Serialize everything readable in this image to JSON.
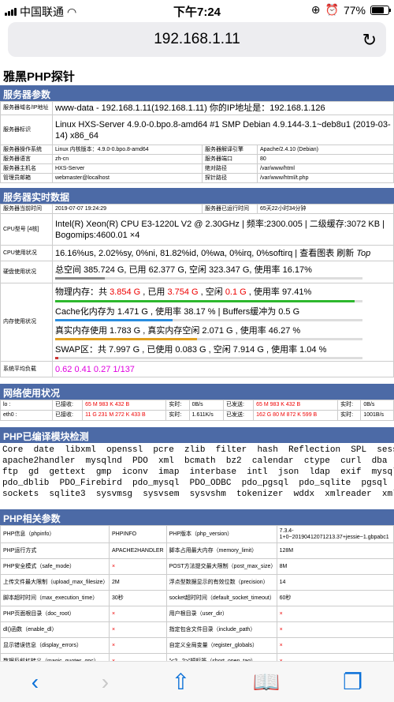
{
  "status": {
    "carrier": "中国联通",
    "time": "下午7:24",
    "battery": "77%"
  },
  "url": "192.168.1.11",
  "title": "雅黑PHP探针",
  "sec1": {
    "title": "服务器参数",
    "rows": [
      [
        "服务器域名/IP地址",
        "www-data - 192.168.1.11(192.168.1.11)  你的IP地址是：192.168.1.126"
      ],
      [
        "服务器标识",
        "Linux HXS-Server 4.9.0-0.bpo.8-amd64 #1 SMP Debian 4.9.144-3.1~deb8u1 (2019-03-14) x86_64"
      ]
    ],
    "grid": [
      [
        "服务器操作系统",
        "Linux  内核版本：4.9.0-0.bpo.8-amd64",
        "服务器解译引擎",
        "Apache/2.4.10 (Debian)"
      ],
      [
        "服务器语言",
        "zh-cn",
        "服务器端口",
        "80"
      ],
      [
        "服务器主机名",
        "HXS-Server",
        "绝对路径",
        "/var/www/html"
      ],
      [
        "管理员邮箱",
        "webmaster@localhost",
        "探针路径",
        "/var/www/html/t.php"
      ]
    ]
  },
  "sec2": {
    "title": "服务器实时数据",
    "time_label": "服务器当前时间",
    "time_value": "2019-07-07 19:24:29",
    "uptime_label": "服务器已运行时间",
    "uptime_value": "65天22小时34分钟",
    "cpu_label": "CPU型号 [4核]",
    "cpu_value": "Intel(R) Xeon(R) CPU E3-1220L V2 @ 2.30GHz | 频率:2300.005 | 二级缓存:3072 KB | Bogomips:4600.01 ×4",
    "cpuuse_label": "CPU使用状况",
    "cpuuse_value": "16.16%us, 2.02%sy, 0%ni, 81.82%id, 0%wa, 0%irq, 0%softirq | 查看图表  刷新",
    "cpuuse_top": "Top",
    "disk_label": "硬盘使用状况",
    "disk": {
      "t1": "总空间 385.724 G,  已用 ",
      "used": "62.377",
      "t2": " G,  空闲 323.347 G,  使用率 16.17%",
      "pct": 16.17
    },
    "mem_label": "内存使用状况",
    "mem1": {
      "t1": "物理内存：共 ",
      "total": "3.854 G",
      "t2": " , 已用 ",
      "used": "3.754 G",
      "t3": " , 空闲 ",
      "free": "0.1 G",
      "t4": " , 使用率 97.41%",
      "pct": 97.41
    },
    "mem2": {
      "text": "Cache化内存为 1.471 G , 使用率 38.17 % | Buffers缓冲为 0.5 G",
      "pct": 38.17
    },
    "mem3": {
      "text": "真实内存使用 1.783 G , 真实内存空闲 2.071 G , 使用率 46.27 %",
      "pct": 46.27
    },
    "mem4": {
      "text": "SWAP区：共 7.997 G , 已使用 0.083 G , 空闲 7.914 G , 使用率 1.04 %",
      "pct": 1.04
    },
    "load_label": "系统平均负载",
    "load_value": "0.62 0.41 0.27 1/137"
  },
  "sec3": {
    "title": "网络使用状况",
    "rows": [
      [
        "lo :",
        "已接收:",
        "65 M 983 K 432 B",
        "实时:",
        "0B/s",
        "已发送:",
        "65 M 983 K 432 B",
        "实时:",
        "0B/s"
      ],
      [
        "eth0 :",
        "已接收:",
        "11 G 231 M 272 K 433 B",
        "实时:",
        "1.611K/s",
        "已发送:",
        "162 G 80 M 872 K 599 B",
        "实时:",
        "1001B/s"
      ]
    ]
  },
  "sec4": {
    "title": "PHP已编译模块检测",
    "lines": [
      "Core  date  libxml  openssl  pcre  zlib  filter  hash  Reflection  SPL  session",
      "apache2handler  mysqlnd  PDO  xml  bcmath  bz2  calendar  ctype  curl  dba  dom",
      "ftp  gd  gettext  gmp  iconv  imap  interbase  intl  json  ldap  exif  mysqli",
      "pdo_dblib  PDO_Firebird  pdo_mysql  PDO_ODBC  pdo_pgsql  pdo_sqlite  pgsql",
      "sockets  sqlite3  sysvmsg  sysvsem  sysvshm  tokenizer  wddx  xmlreader  xmlrpc"
    ]
  },
  "sec5": {
    "title": "PHP相关参数",
    "rows": [
      [
        "PHP信息（phpinfo）",
        "PHPINFO",
        "PHP版本（php_version）",
        "7.3.4-1+0~20190412071213.37+jessie~1.gbpabc1"
      ],
      [
        "PHP运行方式",
        "APACHE2HANDLER",
        "脚本占用最大内存（memory_limit）",
        "128M"
      ],
      [
        "PHP安全模式（safe_mode）",
        "×",
        "POST方法提交最大限制（post_max_size）",
        "8M"
      ],
      [
        "上传文件最大限制（upload_max_filesize）",
        "2M",
        "浮点型数据显示的有效位数（precision）",
        "14"
      ],
      [
        "脚本超时时间（max_execution_time）",
        "30秒",
        "socket超时时间（default_socket_timeout）",
        "60秒"
      ],
      [
        "PHP页面根目录（doc_root）",
        "×",
        "用户根目录（user_dir）",
        "×"
      ],
      [
        "dl()函数（enable_dl）",
        "×",
        "指定包含文件目录（include_path）",
        "×"
      ],
      [
        "显示错误信息（display_errors）",
        "×",
        "自定义全局变量（register_globals）",
        "×"
      ],
      [
        "数据反斜杠转义（magic_quotes_gpc）",
        "×",
        "\"<?...?>\"短标签（short_open_tag）",
        "×"
      ],
      [
        "\"<% %>\"ASP风格标记（asp_tags）",
        "×",
        "忽略重复错误信息（ignore_repeated_errors）",
        "×"
      ],
      [
        "忽略重复的错误源",
        "",
        "",
        " "
      ]
    ]
  },
  "toolbar": {
    "back": "‹",
    "forward": "›",
    "share": "⇧",
    "books": "📖",
    "tabs": "❐"
  },
  "colors": {
    "section": "#4c6aa6",
    "red": "#e00",
    "load": "#e000e0",
    "bar_mem": "#2db82d",
    "bar_cache": "#2a8ee0",
    "bar_real": "#e0a020",
    "bar_swap": "#cc3333",
    "bar_disk": "#888888"
  }
}
